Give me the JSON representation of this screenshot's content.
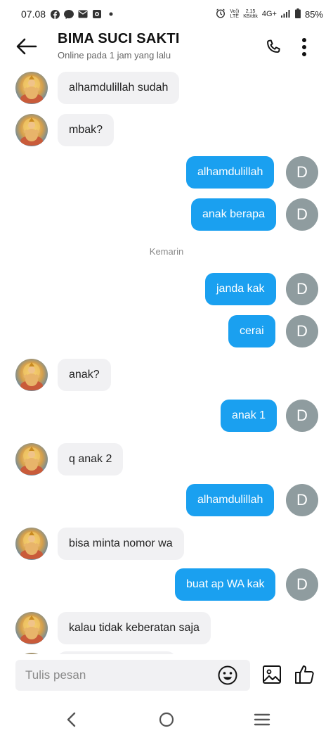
{
  "status_bar": {
    "time": "07.08",
    "icons": [
      "facebook-icon",
      "messenger-icon",
      "mail-icon",
      "app-icon",
      "dot-icon"
    ],
    "network_top": "Vo))",
    "network_bottom": "LTE",
    "speed_top": "2,15",
    "speed_bottom": "KB/dtk",
    "signal": "4G+",
    "battery": "85%"
  },
  "header": {
    "title": "BIMA SUCI SAKTI",
    "subtitle": "Online pada 1 jam yang lalu",
    "back_icon": "arrow-left-icon",
    "call_icon": "phone-icon",
    "more_icon": "more-vertical-icon"
  },
  "messages": [
    {
      "direction": "in",
      "text": "alhamdulillah sudah"
    },
    {
      "direction": "in",
      "text": "mbak?"
    },
    {
      "direction": "out",
      "text": "alhamdulillah",
      "avatar": "D"
    },
    {
      "direction": "out",
      "text": "anak berapa",
      "avatar": "D"
    },
    {
      "direction": "out",
      "text": "janda kak",
      "avatar": "D"
    },
    {
      "direction": "out",
      "text": "cerai",
      "avatar": "D"
    },
    {
      "direction": "in",
      "text": "anak?"
    },
    {
      "direction": "out",
      "text": "anak 1",
      "avatar": "D"
    },
    {
      "direction": "in",
      "text": "q anak 2"
    },
    {
      "direction": "out",
      "text": "alhamdulillah",
      "avatar": "D"
    },
    {
      "direction": "in",
      "text": "bisa minta nomor wa"
    },
    {
      "direction": "out",
      "text": "buat ap WA kak",
      "avatar": "D"
    },
    {
      "direction": "in",
      "text": "kalau tidak keberatan saja"
    }
  ],
  "date_separator": "Kemarin",
  "input": {
    "placeholder": "Tulis pesan",
    "value": "",
    "emoji_icon": "smiley-icon",
    "image_icon": "image-icon",
    "like_icon": "thumbs-up-icon"
  },
  "nav": {
    "back_icon": "nav-back-icon",
    "home_icon": "nav-home-icon",
    "recents_icon": "nav-recents-icon"
  },
  "colors": {
    "outgoing_bubble": "#1aa0f0",
    "incoming_bubble": "#f1f1f3",
    "self_avatar": "#8f9c9f"
  }
}
